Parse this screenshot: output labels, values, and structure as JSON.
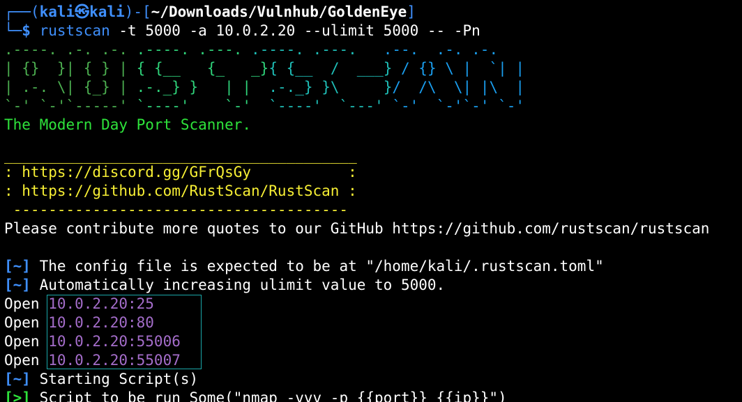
{
  "prompt": {
    "corner_top": "┌──(",
    "user": "kali",
    "at_icon": "㉿",
    "host": "kali",
    "mid": ")-[",
    "path": "~/Downloads/Vulnhub/GoldenEye",
    "close": "]",
    "corner_bottom": "└─",
    "dollar": "$ ",
    "command": "rustscan",
    "args": " -t 5000 -a 10.0.2.20 --ulimit 5000 -- -Pn"
  },
  "banner": {
    "rows": [
      [
        ".----. ",
        ".-. .-. ",
        ".----. ",
        ".---. ",
        ".----. ",
        ".---. ",
        "  .--. ",
        " .-. .-."
      ],
      [
        "| {}  }",
        "| { } | ",
        "{ {__   ",
        "{_   _}",
        "{ {__  ",
        "/  ___}",
        " / {} \\ ",
        "|  `| |"
      ],
      [
        "| .-. \\",
        "| {_} | ",
        ".-._} } ",
        "  | |  ",
        ".-._} }",
        "\\     }",
        "/  /\\  \\",
        "| |\\  |"
      ],
      [
        "`-' `-'",
        "`-----' ",
        "`----'  ",
        "  `-'  ",
        "`----' ",
        " `---' ",
        "`-'  `-'",
        "`-' `-'"
      ]
    ],
    "tagline": "The Modern Day Port Scanner."
  },
  "links_box": {
    "top_rule": "________________________________________",
    "line1": ": https://discord.gg/GFrQsGy           :",
    "line2": ": https://github.com/RustScan/RustScan :",
    "bottom_rule": " --------------------------------------"
  },
  "quote": "Please contribute more quotes to our GitHub https://github.com/rustscan/rustscan",
  "messages": [
    {
      "tag": "[~]",
      "text": " The config file is expected to be at \"/home/kali/.rustscan.toml\""
    },
    {
      "tag": "[~]",
      "text": " Automatically increasing ulimit value to 5000."
    }
  ],
  "open_label": "Open ",
  "open_ports": [
    "10.0.2.20:25",
    "10.0.2.20:80",
    "10.0.2.20:55006",
    "10.0.2.20:55007"
  ],
  "script_msgs": [
    {
      "tag": "[~]",
      "text": " Starting Script(s)",
      "kind": "blue"
    },
    {
      "tag": "[>]",
      "text": " Script to be run Some(\"nmap -vvv -p {{port}} {{ip}}\")",
      "kind": "green"
    }
  ],
  "colors": {
    "background": "#000000",
    "prompt_blue": "#3f8ffb",
    "green": "#2ee33b",
    "yellow": "#f7ef34",
    "purple": "#a46dca",
    "box_teal": "#1aa9aa"
  }
}
